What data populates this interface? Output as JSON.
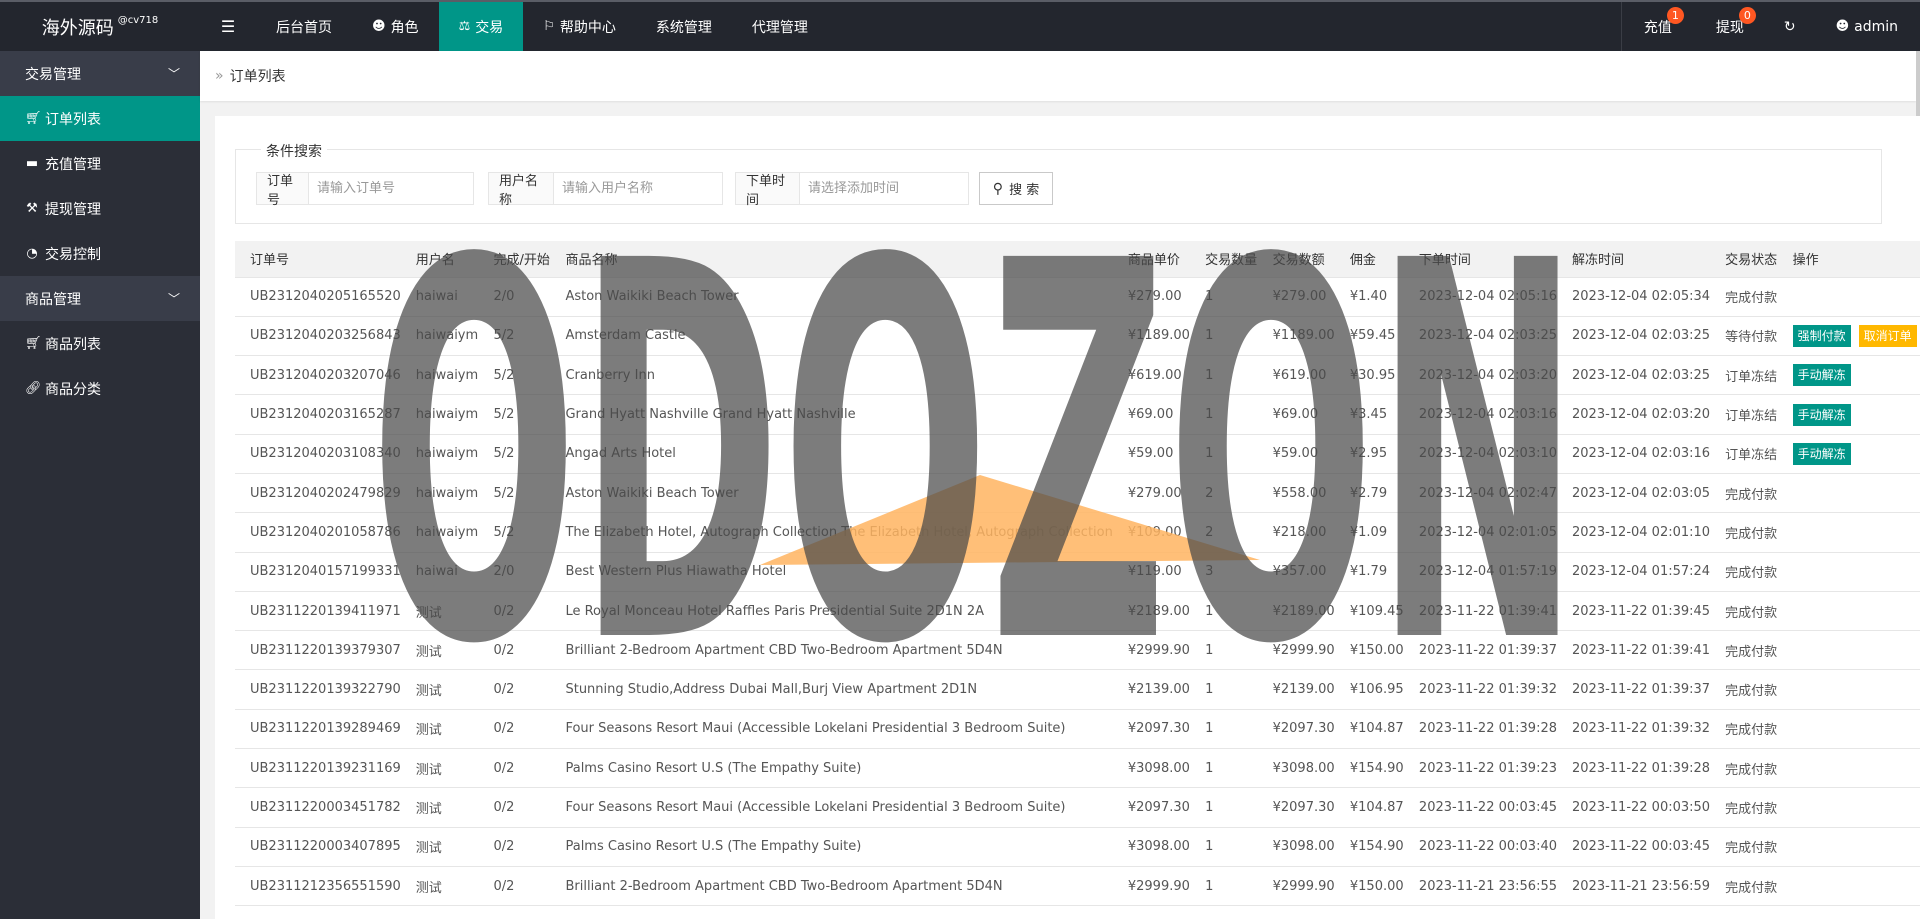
{
  "header": {
    "logo": "海外源码",
    "logo_sup": "@cv718",
    "nav": [
      {
        "label": "后台首页",
        "icon": ""
      },
      {
        "label": "角色",
        "icon": "user-icon"
      },
      {
        "label": "交易",
        "icon": "scale-icon"
      },
      {
        "label": "帮助中心",
        "icon": "flag-icon"
      },
      {
        "label": "系统管理",
        "icon": ""
      },
      {
        "label": "代理管理",
        "icon": ""
      }
    ],
    "right": {
      "recharge": "充值",
      "recharge_badge": "1",
      "withdraw": "提现",
      "withdraw_badge": "0",
      "user": "admin"
    }
  },
  "sidebar": {
    "group1": "交易管理",
    "items1": [
      "订单列表",
      "充值管理",
      "提现管理",
      "交易控制"
    ],
    "group2": "商品管理",
    "items2": [
      "商品列表",
      "商品分类"
    ]
  },
  "breadcrumb": "订单列表",
  "search": {
    "legend": "条件搜索",
    "order_label": "订单号",
    "order_placeholder": "请输入订单号",
    "user_label": "用户名称",
    "user_placeholder": "请输入用户名称",
    "time_label": "下单时间",
    "time_placeholder": "请选择添加时间",
    "button": "搜 索"
  },
  "table": {
    "headers": [
      "订单号",
      "用户名",
      "完成/开始",
      "商品名称",
      "商品单价",
      "交易数量",
      "交易数额",
      "佣金",
      "下单时间",
      "解冻时间",
      "交易状态",
      "操作"
    ],
    "rows": [
      [
        "UB2312040205165520",
        "haiwai",
        "2/0",
        "Aston Waikiki Beach Tower",
        "¥279.00",
        "1",
        "¥279.00",
        "¥1.40",
        "2023-12-04 02:05:16",
        "2023-12-04 02:05:34",
        "完成付款",
        []
      ],
      [
        "UB2312040203256843",
        "haiwaiym",
        "5/2",
        "Amsterdam Castle",
        "¥1189.00",
        "1",
        "¥1189.00",
        "¥59.45",
        "2023-12-04 02:03:25",
        "2023-12-04 02:03:25",
        "等待付款",
        [
          "强制付款",
          "取消订单"
        ]
      ],
      [
        "UB2312040203207046",
        "haiwaiym",
        "5/2",
        "Cranberry Inn",
        "¥619.00",
        "1",
        "¥619.00",
        "¥30.95",
        "2023-12-04 02:03:20",
        "2023-12-04 02:03:25",
        "订单冻结",
        [
          "手动解冻"
        ]
      ],
      [
        "UB2312040203165287",
        "haiwaiym",
        "5/2",
        "Grand Hyatt Nashville Grand Hyatt Nashville",
        "¥69.00",
        "1",
        "¥69.00",
        "¥3.45",
        "2023-12-04 02:03:16",
        "2023-12-04 02:03:20",
        "订单冻结",
        [
          "手动解冻"
        ]
      ],
      [
        "UB2312040203108340",
        "haiwaiym",
        "5/2",
        "Angad Arts Hotel",
        "¥59.00",
        "1",
        "¥59.00",
        "¥2.95",
        "2023-12-04 02:03:10",
        "2023-12-04 02:03:16",
        "订单冻结",
        [
          "手动解冻"
        ]
      ],
      [
        "UB2312040202479829",
        "haiwaiym",
        "5/2",
        "Aston Waikiki Beach Tower",
        "¥279.00",
        "2",
        "¥558.00",
        "¥2.79",
        "2023-12-04 02:02:47",
        "2023-12-04 02:03:05",
        "完成付款",
        []
      ],
      [
        "UB2312040201058786",
        "haiwaiym",
        "5/2",
        "The Elizabeth Hotel, Autograph Collection The Elizabeth Hotel, Autograph Collection",
        "¥109.00",
        "2",
        "¥218.00",
        "¥1.09",
        "2023-12-04 02:01:05",
        "2023-12-04 02:01:10",
        "完成付款",
        []
      ],
      [
        "UB2312040157199331",
        "haiwai",
        "2/0",
        "Best Western Plus Hiawatha Hotel",
        "¥119.00",
        "3",
        "¥357.00",
        "¥1.79",
        "2023-12-04 01:57:19",
        "2023-12-04 01:57:24",
        "完成付款",
        []
      ],
      [
        "UB2311220139411971",
        "测试",
        "0/2",
        "Le Royal Monceau Hotel Raffles Paris Presidential Suite 2D1N 2A",
        "¥2189.00",
        "1",
        "¥2189.00",
        "¥109.45",
        "2023-11-22 01:39:41",
        "2023-11-22 01:39:45",
        "完成付款",
        []
      ],
      [
        "UB2311220139379307",
        "测试",
        "0/2",
        "Brilliant 2-Bedroom Apartment CBD Two-Bedroom Apartment 5D4N",
        "¥2999.90",
        "1",
        "¥2999.90",
        "¥150.00",
        "2023-11-22 01:39:37",
        "2023-11-22 01:39:41",
        "完成付款",
        []
      ],
      [
        "UB2311220139322790",
        "测试",
        "0/2",
        "Stunning Studio,Address Dubai Mall,Burj View Apartment 2D1N",
        "¥2139.00",
        "1",
        "¥2139.00",
        "¥106.95",
        "2023-11-22 01:39:32",
        "2023-11-22 01:39:37",
        "完成付款",
        []
      ],
      [
        "UB2311220139289469",
        "测试",
        "0/2",
        "Four Seasons Resort Maui (Accessible Lokelani Presidential 3 Bedroom Suite)",
        "¥2097.30",
        "1",
        "¥2097.30",
        "¥104.87",
        "2023-11-22 01:39:28",
        "2023-11-22 01:39:32",
        "完成付款",
        []
      ],
      [
        "UB2311220139231169",
        "测试",
        "0/2",
        "Palms Casino Resort U.S (The Empathy Suite)",
        "¥3098.00",
        "1",
        "¥3098.00",
        "¥154.90",
        "2023-11-22 01:39:23",
        "2023-11-22 01:39:28",
        "完成付款",
        []
      ],
      [
        "UB2311220003451782",
        "测试",
        "0/2",
        "Four Seasons Resort Maui (Accessible Lokelani Presidential 3 Bedroom Suite)",
        "¥2097.30",
        "1",
        "¥2097.30",
        "¥104.87",
        "2023-11-22 00:03:45",
        "2023-11-22 00:03:50",
        "完成付款",
        []
      ],
      [
        "UB2311220003407895",
        "测试",
        "0/2",
        "Palms Casino Resort U.S (The Empathy Suite)",
        "¥3098.00",
        "1",
        "¥3098.00",
        "¥154.90",
        "2023-11-22 00:03:40",
        "2023-11-22 00:03:45",
        "完成付款",
        []
      ],
      [
        "UB2311212356551590",
        "测试",
        "0/2",
        "Brilliant 2-Bedroom Apartment CBD Two-Bedroom Apartment 5D4N",
        "¥2999.90",
        "1",
        "¥2999.90",
        "¥150.00",
        "2023-11-21 23:56:55",
        "2023-11-21 23:56:59",
        "完成付款",
        []
      ]
    ]
  },
  "watermark": "ODOZON",
  "colors": {
    "accent": "#009688",
    "orange": "#ffb800",
    "badge": "#ff5722",
    "topbar": "#23262e",
    "sidebar": "#2b2e37"
  }
}
